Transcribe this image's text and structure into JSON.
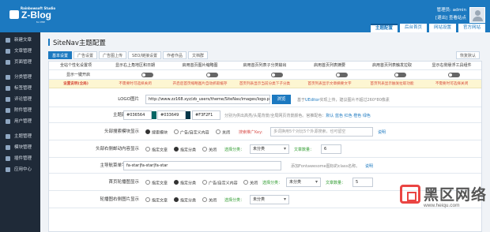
{
  "header": {
    "studio": "Rainbowsoft Studio",
    "brand": "Z-Blog",
    "php": "for PHP",
    "user_prefix": "管理员:",
    "user": "admin",
    "links": "[退出]",
    "view_site": "查看站点"
  },
  "top_tabs": [
    "主题配置",
    "后台首页",
    "网站设置",
    "官方网站"
  ],
  "sidebar": [
    "新建文章",
    "文章管理",
    "页面管理",
    "分类管理",
    "标签管理",
    "评论管理",
    "附件管理",
    "用户管理",
    "主题管理",
    "模块管理",
    "插件管理",
    "应用中心"
  ],
  "page": {
    "title": "SiteNav主题配置",
    "restore": "恢复默认",
    "subtabs": [
      "基本设置",
      "广告设置",
      "广告图上传",
      "SEO/链接设置",
      "作者作品",
      "文档群"
    ]
  },
  "columns": [
    "全站个性化设置项",
    "显示右上角地区和日期",
    "启用首页图片缩略图",
    "启用首页列表子分类输出",
    "启用首页列表摘要",
    "启用首页列表触发拉取",
    "启用首页列表显示提示",
    "显示右侧悬浮工具组件"
  ],
  "toggle_label": "显示一键开启",
  "notes": [
    "设置说明(全局)",
    "不需要时可选择关闭",
    "开启后首页缩略图片自动抓取缓存",
    "首页列表显示当前分类下子分类",
    "首页列表显示文章摘要文字",
    "首页列表显示触发拉取功能",
    "首页列表显示提示插件",
    "不需要时可选择关闭"
  ],
  "logo": {
    "label": "LOGO图片",
    "url": "http://www.zz168.xyz/zb_users/theme/SiteNav/images/logo.pi",
    "browse": "浏览",
    "hint_pre": "基于",
    "hint_editor": "UEditor",
    "hint_post": "实现上传，建议图片不超过260*80像素"
  },
  "color": {
    "label": "主题颜色设置",
    "c1": "#036564",
    "c2": "#033649",
    "c3": "#F3F2F1",
    "swatch1": "#036564",
    "swatch2": "#033649",
    "hint": "分别为供出高亮/头尾背景/全局网页背景颜色。官推配色：",
    "presets": [
      "默认",
      "蓝色",
      "红色",
      "橙色",
      "绿色"
    ]
  },
  "search": {
    "label": "头部搜索模块显示",
    "options": [
      "搜索模块",
      "广告/自定义内容",
      "关闭"
    ],
    "ad_label": "搜索推广Key:",
    "placeholder": "多词换用5个对比5个外源搜索，也可留空",
    "help": "说明"
  },
  "hotcat": {
    "label": "头部右侧邮动内容显示",
    "options": [
      "指定文章",
      "指定分类",
      "关闭"
    ],
    "pick": "选择分类：",
    "category": "未分类",
    "count_label": "文章数量：",
    "count": "6"
  },
  "icons": {
    "label": "主导航菜单字体图标",
    "value": "fa-star|fa-star|fa-star",
    "hint": "添加Fontawesome图标的class名称。",
    "help": "说明"
  },
  "slider": {
    "label": "首页轮播图显示",
    "options": [
      "指定文章",
      "指定分类",
      "广告/自定义内容",
      "关闭"
    ],
    "pick": "选择分类：",
    "category": "未分类",
    "count_label": "文章数量：",
    "count": "5"
  },
  "slider2": {
    "label": "轮播图右侧图片显示",
    "options": [
      "指定文章",
      "指定分类",
      "关闭"
    ],
    "pick": "选择分类：",
    "category": "未分类"
  },
  "watermark": {
    "cn": "黑区网络",
    "url": "www.heiqu.com"
  },
  "colors": {
    "brand": "#1c79c0",
    "sidebar": "#1f2a38",
    "note_bg": "#fdf6d2",
    "note_text": "#d64a38"
  }
}
